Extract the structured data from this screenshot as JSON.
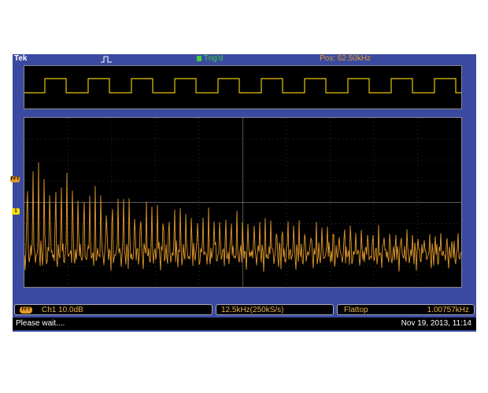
{
  "topbar": {
    "brand": "Tek",
    "trigger_status": "Trig'd",
    "position": "Pos: 62.50kHz"
  },
  "markers": {
    "fft": "FFT",
    "ch1": "1"
  },
  "status": {
    "fft_badge": "FFT",
    "channel_scale": "Ch1  10.0dB",
    "span": "12.5kHz(250kS/s)",
    "window": "Flattop",
    "frequency": "1.00757kHz"
  },
  "footer": {
    "message": "Please wait....",
    "datetime": "Nov 19, 2013, 11:14"
  },
  "colors": {
    "frame": "#3a4aa0",
    "trace_time": "#e6c800",
    "trace_fft": "#e39a2a",
    "grid": "#555555"
  }
}
